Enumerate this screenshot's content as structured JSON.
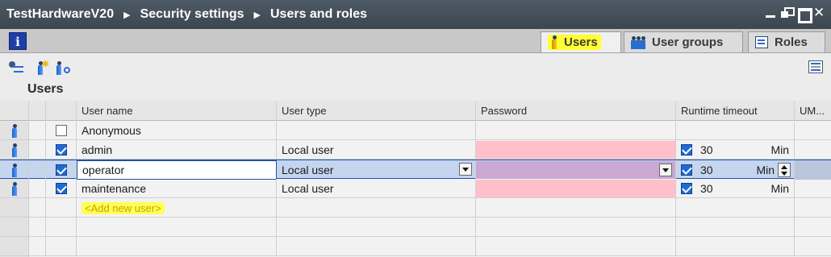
{
  "titlebar": {
    "crumbs": [
      "TestHardwareV20",
      "Security settings",
      "Users and roles"
    ]
  },
  "tabs": [
    {
      "label": "Users",
      "icon": "user-icon",
      "active": true
    },
    {
      "label": "User groups",
      "icon": "user-group-icon",
      "active": false
    },
    {
      "label": "Roles",
      "icon": "roles-icon",
      "active": false
    }
  ],
  "section_title": "Users",
  "table": {
    "columns": [
      "User name",
      "User type",
      "Password",
      "Runtime timeout",
      "UM..."
    ],
    "rows": [
      {
        "name": "Anonymous",
        "type": "",
        "enabled": false,
        "timeout": "",
        "unit": ""
      },
      {
        "name": "admin",
        "type": "Local user",
        "enabled": true,
        "timeout": "30",
        "unit": "Min"
      },
      {
        "name": "operator",
        "type": "Local user",
        "enabled": true,
        "timeout": "30",
        "unit": "Min"
      },
      {
        "name": "maintenance",
        "type": "Local user",
        "enabled": true,
        "timeout": "30",
        "unit": "Min"
      }
    ],
    "add_new": "<Add new user>"
  },
  "colors": {
    "titlebar": "#3c4650",
    "highlight": "#ffff33",
    "password_invalid": "#ffc0cb",
    "selection": "#c6d5ee"
  }
}
